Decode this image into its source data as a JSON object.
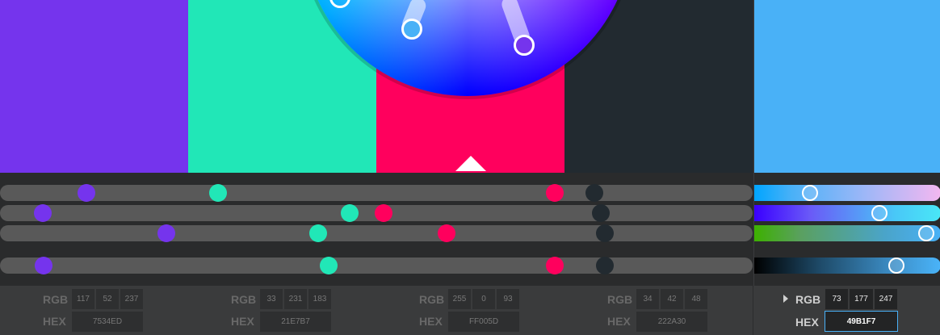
{
  "palette": [
    {
      "hex_label": "HEX",
      "rgb_label": "RGB",
      "r": "117",
      "g": "52",
      "b": "237",
      "hex": "7534ED",
      "color": "#7534ED"
    },
    {
      "hex_label": "HEX",
      "rgb_label": "RGB",
      "r": "33",
      "g": "231",
      "b": "183",
      "hex": "21E7B7",
      "color": "#21E7B7"
    },
    {
      "hex_label": "HEX",
      "rgb_label": "RGB",
      "r": "255",
      "g": "0",
      "b": "93",
      "hex": "FF005D",
      "color": "#FF005D"
    },
    {
      "hex_label": "HEX",
      "rgb_label": "RGB",
      "r": "34",
      "g": "42",
      "b": "48",
      "hex": "222A30",
      "color": "#222A30"
    }
  ],
  "active": {
    "rgb_label": "RGB",
    "hex_label": "HEX",
    "r": "73",
    "g": "177",
    "b": "247",
    "hex": "49B1F7",
    "color": "#49B1F7",
    "expand_icon": "triangle-right-icon"
  },
  "slider_values": {
    "hue": [
      0.115,
      0.29,
      0.737,
      0.79
    ],
    "saturation": [
      0.057,
      0.465,
      0.51,
      0.798
    ],
    "brightness": [
      0.221,
      0.423,
      0.593,
      0.804
    ],
    "lightness": [
      0.058,
      0.437,
      0.737,
      0.804
    ]
  },
  "active_slider_values": {
    "hue": 0.3,
    "saturation": 0.67,
    "brightness": 0.92,
    "lightness": 0.76
  },
  "colors": {
    "track": "#595959",
    "background": "#2a2b2c",
    "bottom_bar": "#3a3b3c"
  }
}
